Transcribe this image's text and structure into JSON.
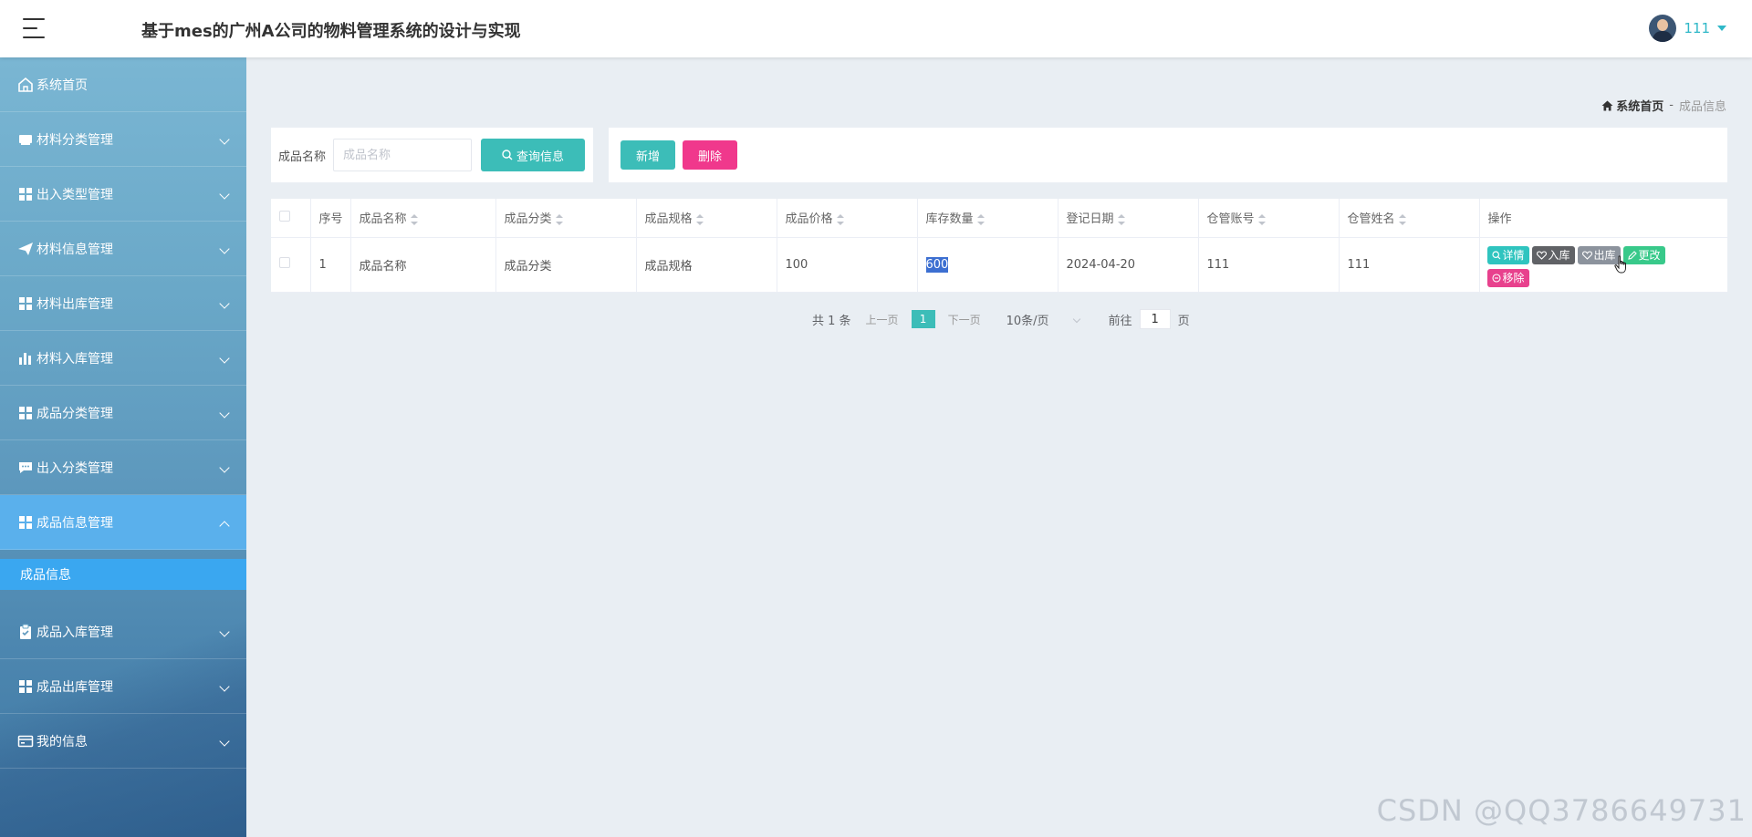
{
  "header": {
    "title": "基于mes的广州A公司的物料管理系统的设计与实现",
    "username": "111"
  },
  "sidebar": {
    "items": [
      {
        "label": "系统首页",
        "icon": "home-icon"
      },
      {
        "label": "材料分类管理",
        "icon": "inbox-icon"
      },
      {
        "label": "出入类型管理",
        "icon": "grid-icon"
      },
      {
        "label": "材料信息管理",
        "icon": "paper-plane-icon"
      },
      {
        "label": "材料出库管理",
        "icon": "grid-icon"
      },
      {
        "label": "材料入库管理",
        "icon": "bar-chart-icon"
      },
      {
        "label": "成品分类管理",
        "icon": "grid-icon"
      },
      {
        "label": "出入分类管理",
        "icon": "chat-icon"
      },
      {
        "label": "成品信息管理",
        "icon": "grid-icon"
      },
      {
        "label": "成品入库管理",
        "icon": "clipboard-icon"
      },
      {
        "label": "成品出库管理",
        "icon": "grid-icon"
      },
      {
        "label": "我的信息",
        "icon": "wallet-icon"
      }
    ],
    "active_index": 8,
    "submenu": {
      "label": "成品信息"
    }
  },
  "breadcrumb": {
    "home": "系统首页",
    "separator": "-",
    "current": "成品信息"
  },
  "search": {
    "label": "成品名称",
    "placeholder": "成品名称",
    "button": "查询信息"
  },
  "actions": {
    "add": "新增",
    "delete": "删除"
  },
  "table": {
    "columns": [
      "序号",
      "成品名称",
      "成品分类",
      "成品规格",
      "成品价格",
      "库存数量",
      "登记日期",
      "仓管账号",
      "仓管姓名",
      "操作"
    ],
    "rows": [
      {
        "index": "1",
        "name": "成品名称",
        "category": "成品分类",
        "spec": "成品规格",
        "price": "100",
        "stock": "600",
        "date": "2024-04-20",
        "account": "111",
        "keeper": "111"
      }
    ],
    "ops": {
      "detail": "详情",
      "stock_in": "入库",
      "stock_out": "出库",
      "edit": "更改",
      "remove": "移除"
    }
  },
  "pagination": {
    "total": "共 1 条",
    "prev": "上一页",
    "current": "1",
    "next": "下一页",
    "page_size": "10条/页",
    "goto_prefix": "前往",
    "goto_value": "1",
    "goto_suffix": "页"
  },
  "watermark": "CSDN @QQ3786649731",
  "colors": {
    "accent": "#3cbdb8",
    "danger": "#f0388c",
    "sidebar_active": "#5ab0ec",
    "submenu_active": "#3aa7f0",
    "username": "#2fb8c8"
  }
}
